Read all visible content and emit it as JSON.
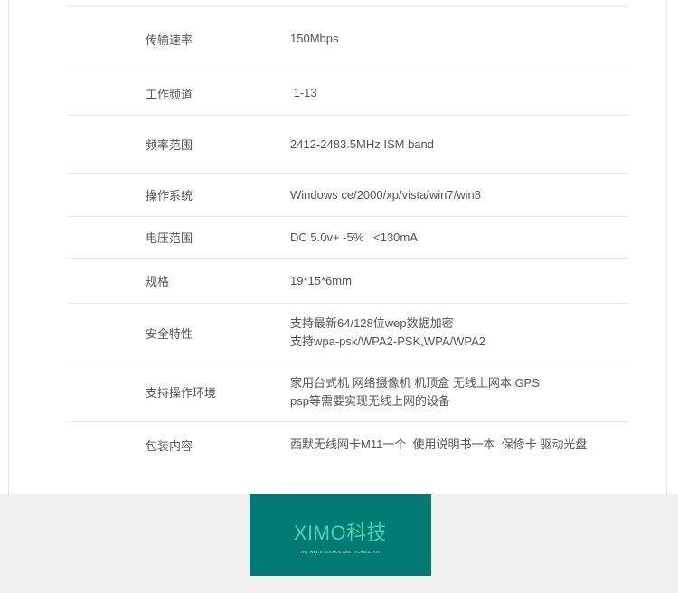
{
  "specs": [
    {
      "label": "传输速率",
      "lines": [
        "150Mbps"
      ]
    },
    {
      "label": "工作频道",
      "lines": [
        " 1-13"
      ]
    },
    {
      "label": "频率范围",
      "lines": [
        "2412-2483.5MHz ISM band"
      ]
    },
    {
      "label": "操作系统",
      "lines": [
        "Windows ce/2000/xp/vista/win7/win8"
      ]
    },
    {
      "label": "电压范围",
      "lines": [
        "DC 5.0v+ -5%   <130mA"
      ]
    },
    {
      "label": "规格",
      "lines": [
        "19*15*6mm"
      ]
    },
    {
      "label": "安全特性",
      "lines": [
        "支持最新64/128位wep数据加密",
        "支持wpa-psk/WPA2-PSK,WPA/WPA2"
      ]
    },
    {
      "label": "支持操作环境",
      "lines": [
        "家用台式机 网络摄像机 机顶盒 无线上网本 GPS",
        "psp等需要实现无线上网的设备"
      ]
    },
    {
      "label": "包装内容",
      "lines": [
        "西默无线网卡M11一个  使用说明书一本  保修卡 驱动光盘"
      ]
    }
  ],
  "brand": {
    "title": "XIMO科技",
    "subtitle": "THE WHITE KOSMOS AND TECHNOLOGY",
    "bg_color": "#007a72",
    "title_color": "#39d9b2"
  }
}
